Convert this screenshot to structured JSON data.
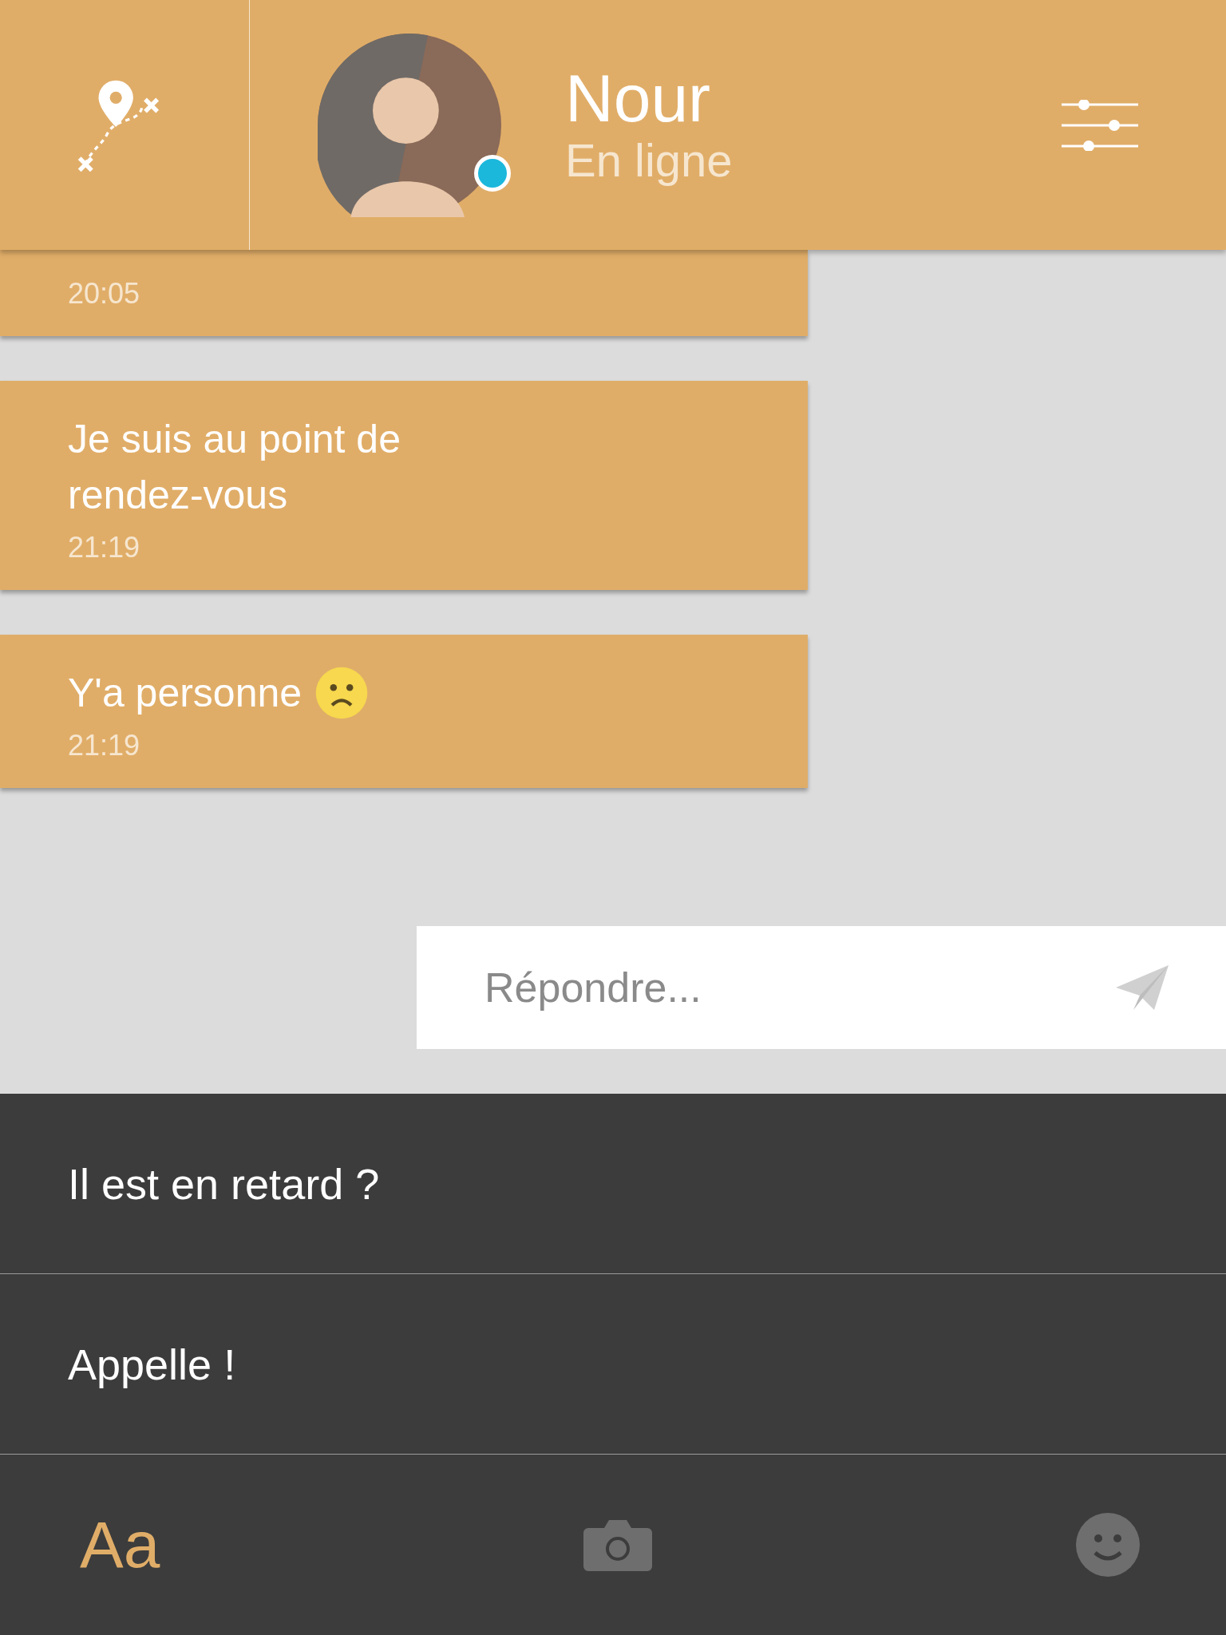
{
  "header": {
    "name": "Nour",
    "status": "En ligne",
    "online": true
  },
  "messages": [
    {
      "kind": "clipped",
      "time": "20:05"
    },
    {
      "kind": "plain",
      "text": "Je suis au point de rendez-vous",
      "time": "21:19"
    },
    {
      "kind": "sad",
      "text": "Y'a personne",
      "time": "21:19"
    }
  ],
  "reply": {
    "placeholder": "Répondre..."
  },
  "suggestions": [
    "Il est en retard ?",
    "Appelle !"
  ],
  "toolbar": {
    "text_button": "Aa"
  }
}
